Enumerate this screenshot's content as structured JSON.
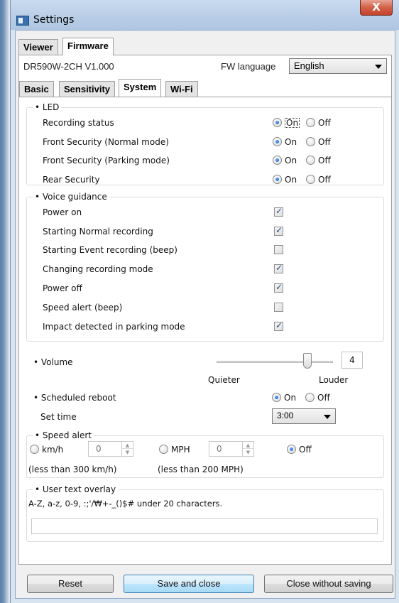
{
  "window": {
    "title": "Settings",
    "close_glyph": "X"
  },
  "top_tabs": {
    "viewer": "Viewer",
    "firmware": "Firmware"
  },
  "firmware": {
    "model_version": "DR590W-2CH  V1.000",
    "fw_language_label": "FW language",
    "fw_language_value": "English"
  },
  "sub_tabs": {
    "basic": "Basic",
    "sensitivity": "Sensitivity",
    "system": "System",
    "wifi": "Wi-Fi"
  },
  "led": {
    "legend": "• LED",
    "on_label": "On",
    "off_label": "Off",
    "items": [
      {
        "label": "Recording status",
        "value": "On"
      },
      {
        "label": "Front Security (Normal mode)",
        "value": "On"
      },
      {
        "label": "Front Security (Parking mode)",
        "value": "On"
      },
      {
        "label": "Rear Security",
        "value": "On"
      }
    ]
  },
  "voice": {
    "legend": "• Voice guidance",
    "items": [
      {
        "label": "Power on",
        "checked": true
      },
      {
        "label": "Starting Normal recording",
        "checked": true
      },
      {
        "label": "Starting Event recording (beep)",
        "checked": false
      },
      {
        "label": "Changing recording mode",
        "checked": true
      },
      {
        "label": "Power off",
        "checked": true
      },
      {
        "label": "Speed alert (beep)",
        "checked": false
      },
      {
        "label": "Impact detected in parking mode",
        "checked": true
      }
    ]
  },
  "volume": {
    "label": "• Volume",
    "value": "4",
    "level_fraction": 0.8,
    "quieter": "Quieter",
    "louder": "Louder"
  },
  "reboot": {
    "label": "• Scheduled reboot",
    "value": "On",
    "on_label": "On",
    "off_label": "Off",
    "set_time_label": "Set time",
    "time_value": "3:00"
  },
  "speed_alert": {
    "legend": "• Speed alert",
    "kmh_label": "km/h",
    "kmh_value": "0",
    "kmh_hint": "(less than 300 km/h)",
    "mph_label": "MPH",
    "mph_value": "0",
    "mph_hint": "(less than 200 MPH)",
    "off_label": "Off",
    "selected": "Off"
  },
  "overlay": {
    "legend": "• User text overlay",
    "hint": "A-Z, a-z, 0-9, :;'/₩+-_()$# under 20 characters.",
    "value": ""
  },
  "buttons": {
    "reset": "Reset",
    "save": "Save and close",
    "close": "Close without saving"
  }
}
